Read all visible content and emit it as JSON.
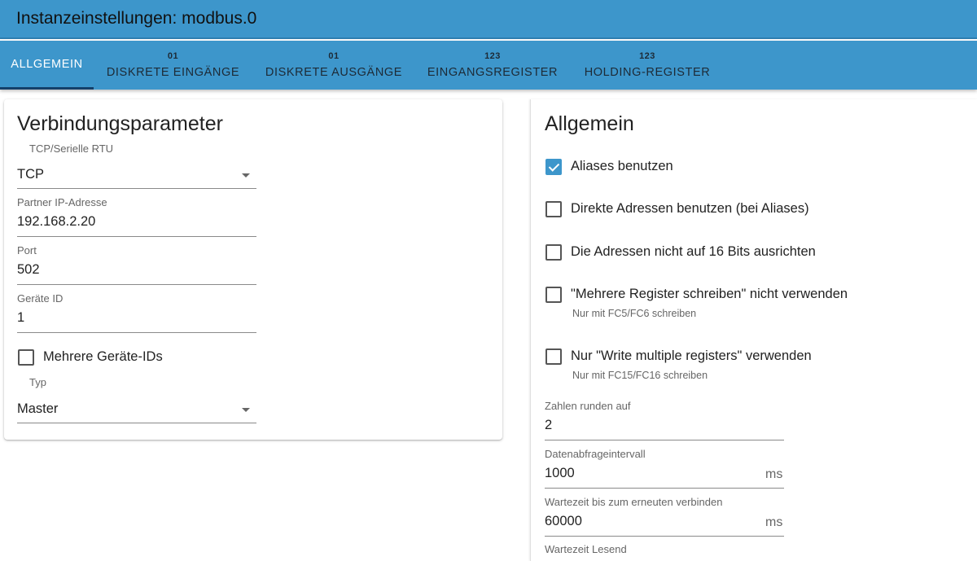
{
  "window": {
    "title": "Instanzeinstellungen: modbus.0"
  },
  "tabs": [
    {
      "icon": "",
      "label": "ALLGEMEIN",
      "active": true
    },
    {
      "icon": "01",
      "label": "DISKRETE EINGÄNGE"
    },
    {
      "icon": "01",
      "label": "DISKRETE AUSGÄNGE"
    },
    {
      "icon": "123",
      "label": "EINGANGSREGISTER"
    },
    {
      "icon": "123",
      "label": "HOLDING-REGISTER"
    }
  ],
  "connection": {
    "title": "Verbindungsparameter",
    "mode": {
      "label": "TCP/Serielle RTU",
      "value": "TCP"
    },
    "ip": {
      "label": "Partner IP-Adresse",
      "value": "192.168.2.20"
    },
    "port": {
      "label": "Port",
      "value": "502"
    },
    "device_id": {
      "label": "Geräte ID",
      "value": "1"
    },
    "multi_ids": {
      "label": "Mehrere Geräte-IDs",
      "checked": false
    },
    "type": {
      "label": "Typ",
      "value": "Master"
    }
  },
  "general": {
    "title": "Allgemein",
    "options": [
      {
        "label": "Aliases benutzen",
        "checked": true,
        "hint": ""
      },
      {
        "label": "Direkte Adressen benutzen (bei Aliases)",
        "checked": false,
        "hint": ""
      },
      {
        "label": "Die Adressen nicht auf 16 Bits ausrichten",
        "checked": false,
        "hint": ""
      },
      {
        "label": "\"Mehrere Register schreiben\" nicht verwenden",
        "checked": false,
        "hint": "Nur mit FC5/FC6 schreiben"
      },
      {
        "label": "Nur \"Write multiple registers\" verwenden",
        "checked": false,
        "hint": "Nur mit FC15/FC16 schreiben"
      }
    ],
    "round": {
      "label": "Zahlen runden auf",
      "value": "2"
    },
    "poll": {
      "label": "Datenabfrageintervall",
      "value": "1000",
      "unit": "ms"
    },
    "reconnect": {
      "label": "Wartezeit bis zum erneuten verbinden",
      "value": "60000",
      "unit": "ms"
    },
    "read_timeout": {
      "label": "Wartezeit Lesend"
    }
  },
  "colors": {
    "accent": "#3d96cb",
    "tab_indicator": "#14406a"
  }
}
